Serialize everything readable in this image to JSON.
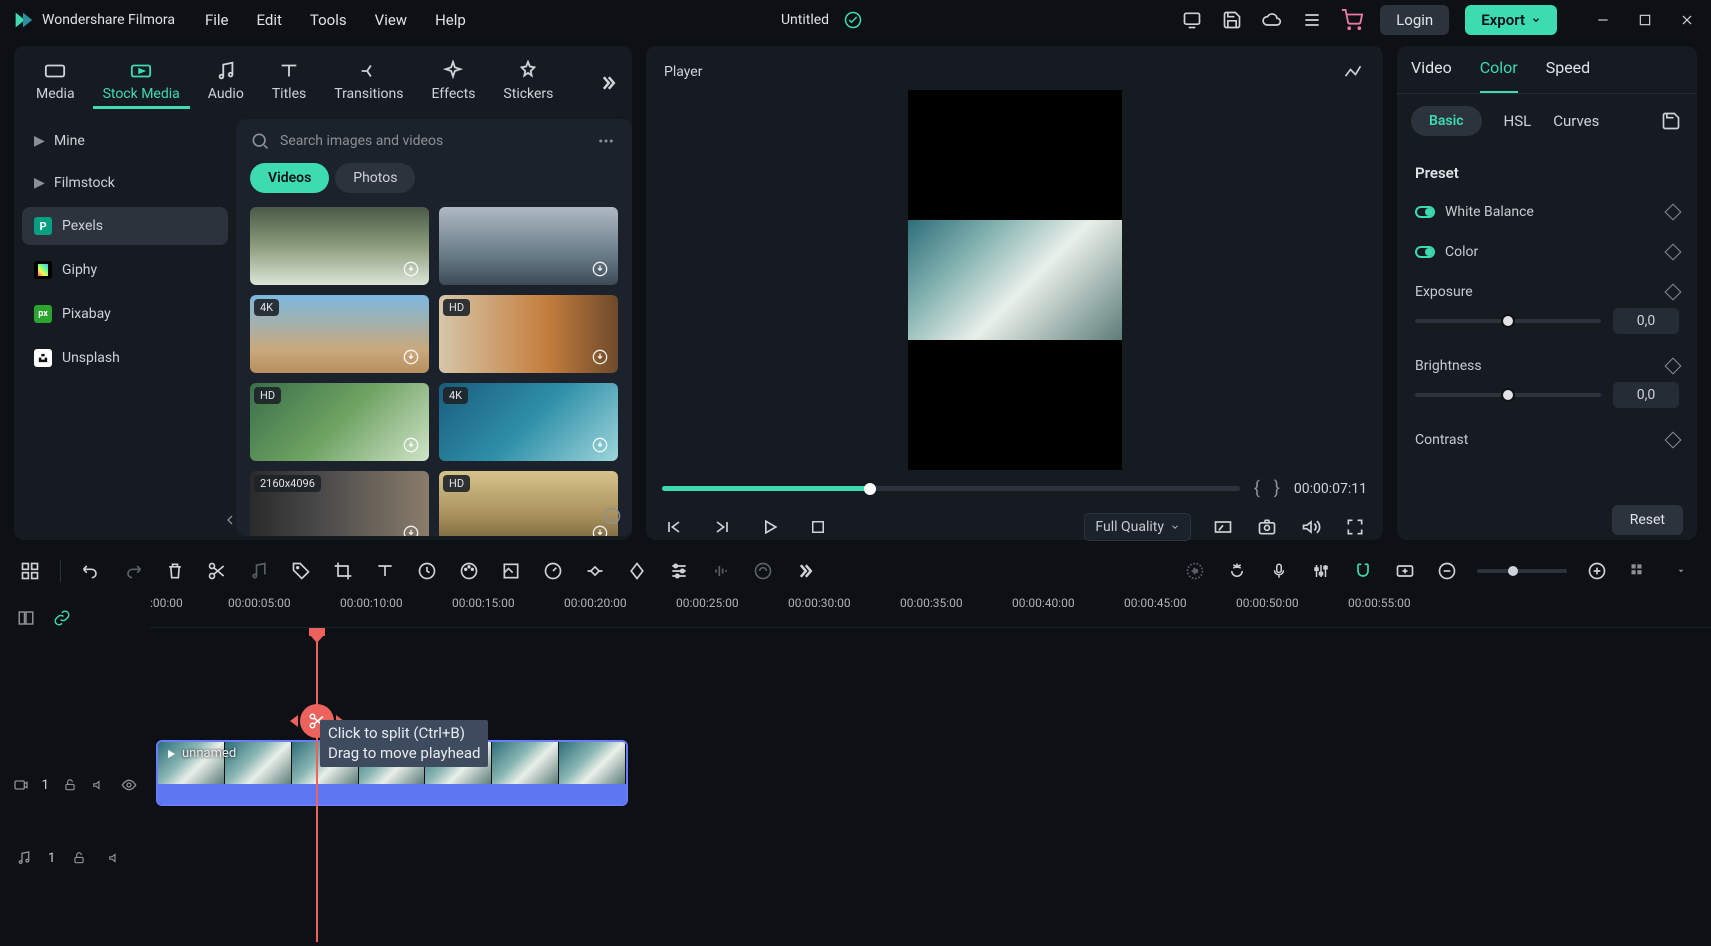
{
  "app_name": "Wondershare Filmora",
  "menubar": [
    "File",
    "Edit",
    "Tools",
    "View",
    "Help"
  ],
  "header": {
    "project_title": "Untitled",
    "login_label": "Login",
    "export_label": "Export"
  },
  "asset_tabs": [
    "Media",
    "Stock Media",
    "Audio",
    "Titles",
    "Transitions",
    "Effects",
    "Stickers"
  ],
  "asset_active": 1,
  "sources": [
    {
      "label": "Mine",
      "has_chev": true
    },
    {
      "label": "Filmstock",
      "has_chev": true
    },
    {
      "label": "Pexels",
      "icon": "P"
    },
    {
      "label": "Giphy",
      "icon": "G"
    },
    {
      "label": "Pixabay",
      "icon": "px"
    },
    {
      "label": "Unsplash",
      "icon": "U"
    }
  ],
  "source_active": 2,
  "search": {
    "placeholder": "Search images and videos"
  },
  "pill_tabs": [
    "Videos",
    "Photos"
  ],
  "pill_active": 0,
  "thumbs": [
    {
      "res": ""
    },
    {
      "res": ""
    },
    {
      "res": "4K"
    },
    {
      "res": "HD"
    },
    {
      "res": "HD"
    },
    {
      "res": "4K"
    },
    {
      "res": "2160x4096"
    },
    {
      "res": "HD"
    }
  ],
  "player": {
    "header": "Player",
    "timecode": "00:00:07:11",
    "quality": "Full Quality"
  },
  "right_panel": {
    "tabs": [
      "Video",
      "Color",
      "Speed"
    ],
    "active": 1,
    "subtabs": [
      "Basic",
      "HSL",
      "Curves"
    ],
    "sub_active": 0,
    "preset_header": "Preset",
    "rows": {
      "white_balance": "White Balance",
      "color": "Color",
      "exposure": "Exposure",
      "exposure_val": "0,0",
      "brightness": "Brightness",
      "brightness_val": "0,0",
      "contrast": "Contrast"
    },
    "reset": "Reset"
  },
  "timeline": {
    "ticks": [
      ":00:00",
      "00:00:05:00",
      "00:00:10:00",
      "00:00:15:00",
      "00:00:20:00",
      "00:00:25:00",
      "00:00:30:00",
      "00:00:35:00",
      "00:00:40:00",
      "00:00:45:00",
      "00:00:50:00",
      "00:00:55:00"
    ],
    "clip_label": "unnamed",
    "tooltip_line1": "Click to split (Ctrl+B)",
    "tooltip_line2": "Drag to move playhead",
    "video_track": "1",
    "audio_track": "1"
  }
}
